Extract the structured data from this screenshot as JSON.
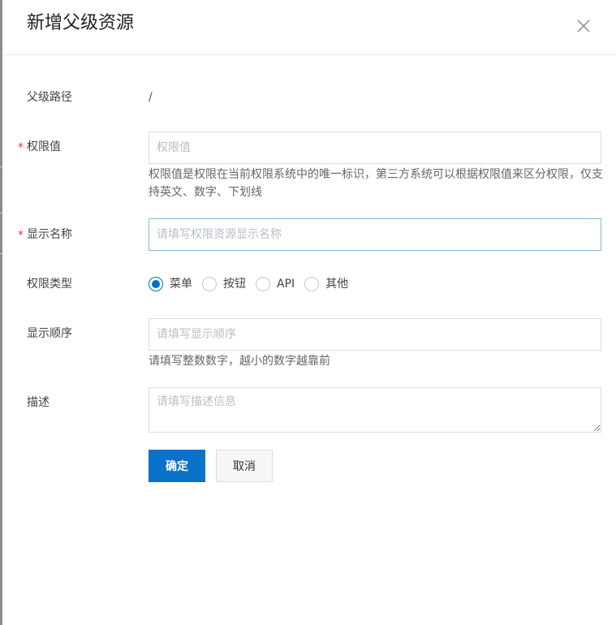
{
  "dialog": {
    "title": "新增父级资源",
    "close_icon": "close-icon"
  },
  "form": {
    "parent_path": {
      "label": "父级路径",
      "value": "/"
    },
    "permission_value": {
      "label": "权限值",
      "required": true,
      "placeholder": "权限值",
      "value": "",
      "help": "权限值是权限在当前权限系统中的唯一标识，第三方系统可以根据权限值来区分权限，仅支持英文、数字、下划线"
    },
    "display_name": {
      "label": "显示名称",
      "required": true,
      "placeholder": "请填写权限资源显示名称",
      "value": ""
    },
    "permission_type": {
      "label": "权限类型",
      "options": [
        "菜单",
        "按钮",
        "API",
        "其他"
      ],
      "selected": "菜单"
    },
    "display_order": {
      "label": "显示顺序",
      "placeholder": "请填写显示顺序",
      "value": "",
      "help": "请填写整数数字，越小的数字越靠前"
    },
    "description": {
      "label": "描述",
      "placeholder": "请填写描述信息",
      "value": ""
    }
  },
  "actions": {
    "confirm_label": "确定",
    "cancel_label": "取消"
  },
  "colors": {
    "primary": "#0a72c9",
    "required_star": "#e53935",
    "placeholder": "#b8bec7",
    "focused_border": "#89b6d6"
  }
}
